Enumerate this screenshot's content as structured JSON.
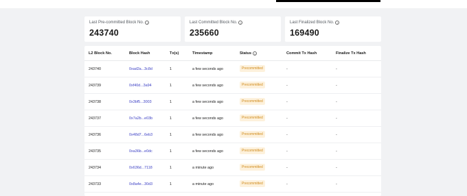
{
  "colors": {
    "page_bg": "#f1f2f4",
    "card_bg": "#ffffff",
    "link": "#3b3fc4",
    "badge_text": "#d08a1a",
    "badge_bg": "#fdf1dc"
  },
  "stats": [
    {
      "label": "Last Pre-committed Block No.",
      "value": "243740",
      "icon": "info-icon"
    },
    {
      "label": "Last Committed Block No.",
      "value": "235660",
      "icon": "info-icon"
    },
    {
      "label": "Last Finalized Block No.",
      "value": "169490",
      "icon": "info-icon"
    }
  ],
  "table": {
    "headers": [
      "L2 Block No.",
      "Block Hash",
      "Tx(s)",
      "Timestamp",
      "Status",
      "Commit Tx Hash",
      "Finalize Tx Hash"
    ],
    "rows": [
      {
        "block": "243740",
        "hash": "0xad2a...3c8d",
        "txs": "1",
        "time": "a few seconds ago",
        "status": "Precommitted",
        "commit": "-",
        "finalize": "-"
      },
      {
        "block": "243739",
        "hash": "0xf40d...3a94",
        "txs": "1",
        "time": "a few seconds ago",
        "status": "Precommitted",
        "commit": "-",
        "finalize": "-"
      },
      {
        "block": "243738",
        "hash": "0x3bf5...3003",
        "txs": "1",
        "time": "a few seconds ago",
        "status": "Precommitted",
        "commit": "-",
        "finalize": "-"
      },
      {
        "block": "243737",
        "hash": "0x7a2b...e03b",
        "txs": "1",
        "time": "a few seconds ago",
        "status": "Precommitted",
        "commit": "-",
        "finalize": "-"
      },
      {
        "block": "243736",
        "hash": "0x48d7...6eb3",
        "txs": "1",
        "time": "a few seconds ago",
        "status": "Precommitted",
        "commit": "-",
        "finalize": "-"
      },
      {
        "block": "243735",
        "hash": "0xa36b...e0dc",
        "txs": "1",
        "time": "a few seconds ago",
        "status": "Precommitted",
        "commit": "-",
        "finalize": "-"
      },
      {
        "block": "243734",
        "hash": "0x636d...7118",
        "txs": "1",
        "time": "a minute ago",
        "status": "Precommitted",
        "commit": "-",
        "finalize": "-"
      },
      {
        "block": "243733",
        "hash": "0x8a4e...30d3",
        "txs": "1",
        "time": "a minute ago",
        "status": "Precommitted",
        "commit": "-",
        "finalize": "-"
      }
    ]
  }
}
